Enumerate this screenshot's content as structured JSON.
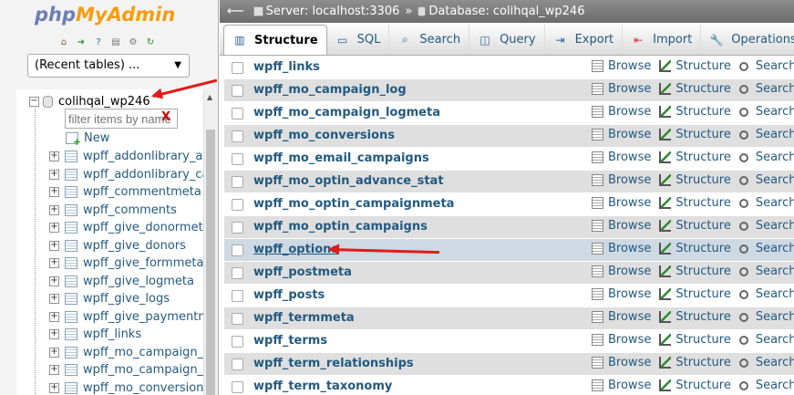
{
  "logo": {
    "php": "php",
    "myadmin": "MyAdmin"
  },
  "nav": {
    "recent_tables": "(Recent tables) ...",
    "database": "colihqal_wp246",
    "filter_placeholder": "filter items by name",
    "filter_clear": "X",
    "new_label": "New",
    "tables": [
      "wpff_addonlibrary_addo",
      "wpff_addonlibrary_cat",
      "wpff_commentmeta",
      "wpff_comments",
      "wpff_give_donormeta",
      "wpff_give_donors",
      "wpff_give_formmeta",
      "wpff_give_logmeta",
      "wpff_give_logs",
      "wpff_give_paymentme",
      "wpff_links",
      "wpff_mo_campaign_lo",
      "wpff_mo_campaign_lo",
      "wpff_mo_conversions"
    ]
  },
  "breadcrumb": {
    "server": "Server: localhost:3306",
    "separator": "»",
    "database": "Database: colihqal_wp246"
  },
  "tabs": [
    "Structure",
    "SQL",
    "Search",
    "Query",
    "Export",
    "Import",
    "Operations"
  ],
  "actions": {
    "browse": "Browse",
    "structure": "Structure",
    "search": "Search"
  },
  "tables": [
    "wpff_links",
    "wpff_mo_campaign_log",
    "wpff_mo_campaign_logmeta",
    "wpff_mo_conversions",
    "wpff_mo_email_campaigns",
    "wpff_mo_optin_advance_stat",
    "wpff_mo_optin_campaignmeta",
    "wpff_mo_optin_campaigns",
    "wpff_options",
    "wpff_postmeta",
    "wpff_posts",
    "wpff_termmeta",
    "wpff_terms",
    "wpff_term_relationships",
    "wpff_term_taxonomy"
  ],
  "highlighted_table": "wpff_options",
  "colors": {
    "arrow": "#e01b1b",
    "link": "#235a81",
    "highlight_row": "#cfd9e3"
  }
}
